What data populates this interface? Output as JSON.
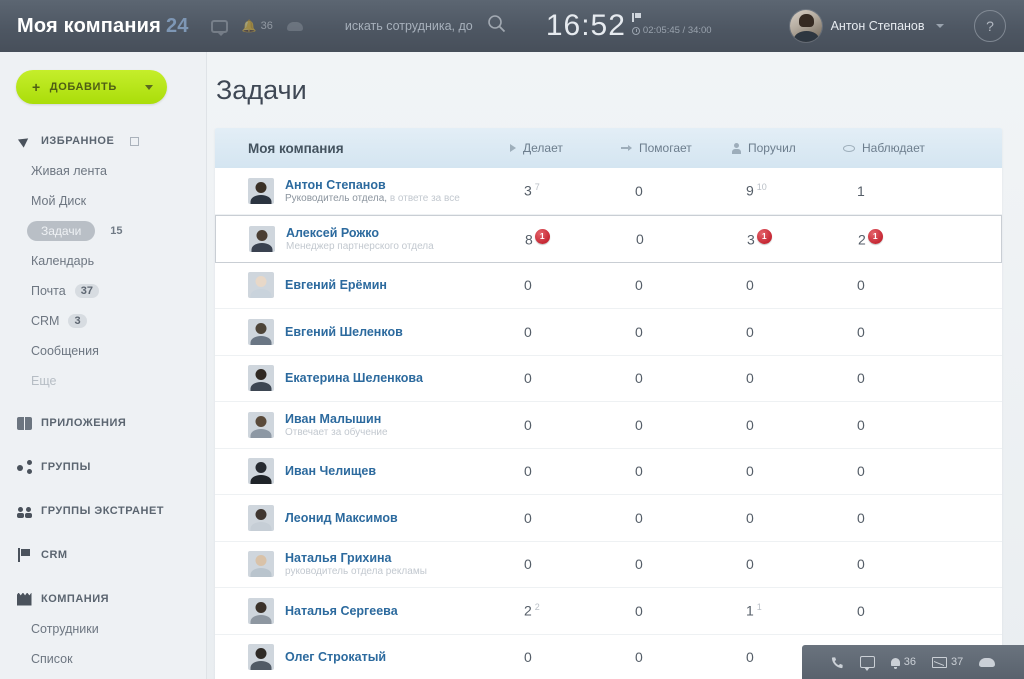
{
  "header": {
    "logo_text": "Моя компания",
    "logo_badge": "24",
    "chat_icon": "chat-icon",
    "notify_icon": "bell-icon",
    "notify_count": "36",
    "cloud_icon": "cloud-icon",
    "search_placeholder": "искать сотрудника, до",
    "search_value": "",
    "search_icon": "search-icon",
    "clock": "16:52",
    "timer": "02:05:45 / 34:00",
    "user_name": "Антон Степанов",
    "help_label": "?"
  },
  "sidebar": {
    "add_button": "ДОБАВИТЬ",
    "groups": [
      {
        "label": "ИЗБРАННОЕ",
        "icon": "pin-icon",
        "has_settings": true,
        "items": [
          {
            "label": "Живая лента",
            "count": "",
            "state": "normal"
          },
          {
            "label": "Мой Диск",
            "count": "",
            "state": "normal"
          },
          {
            "label": "Задачи",
            "count": "15",
            "state": "active"
          },
          {
            "label": "Календарь",
            "count": "",
            "state": "normal"
          },
          {
            "label": "Почта",
            "count": "37",
            "state": "normal"
          },
          {
            "label": "CRM",
            "count": "3",
            "state": "normal"
          },
          {
            "label": "Сообщения",
            "count": "",
            "state": "normal"
          },
          {
            "label": "Еще",
            "count": "",
            "state": "faint"
          }
        ]
      },
      {
        "label": "ПРИЛОЖЕНИЯ",
        "icon": "apps-icon",
        "items": []
      },
      {
        "label": "ГРУППЫ",
        "icon": "share-icon",
        "items": []
      },
      {
        "label": "ГРУППЫ ЭКСТРАНЕТ",
        "icon": "extranet-icon",
        "items": []
      },
      {
        "label": "CRM",
        "icon": "flag-icon",
        "items": []
      },
      {
        "label": "КОМПАНИЯ",
        "icon": "company-icon",
        "items": [
          {
            "label": "Сотрудники",
            "count": "",
            "state": "normal"
          },
          {
            "label": "Список",
            "count": "",
            "state": "normal"
          }
        ]
      }
    ]
  },
  "main": {
    "page_title": "Задачи",
    "grid": {
      "name_header": "Моя компания",
      "columns": [
        {
          "label": "Делает",
          "icon": "play-icon"
        },
        {
          "label": "Помогает",
          "icon": "arrow-right-icon"
        },
        {
          "label": "Поручил",
          "icon": "person-icon"
        },
        {
          "label": "Наблюдает",
          "icon": "eye-icon"
        }
      ],
      "rows": [
        {
          "name": "Антон Степанов",
          "subtitle": "Руководитель отдела,",
          "subtitle_muted": "в ответе за все",
          "selected": false,
          "cells": [
            {
              "value": "3",
              "sup": "7",
              "badge": ""
            },
            {
              "value": "0",
              "sup": "",
              "badge": ""
            },
            {
              "value": "9",
              "sup": "10",
              "badge": ""
            },
            {
              "value": "1",
              "sup": "",
              "badge": ""
            }
          ]
        },
        {
          "name": "Алексей Рожко",
          "subtitle": "",
          "subtitle_muted": "Менеджер партнерского отдела",
          "selected": true,
          "cells": [
            {
              "value": "8",
              "sup": "",
              "badge": "1"
            },
            {
              "value": "0",
              "sup": "",
              "badge": ""
            },
            {
              "value": "3",
              "sup": "",
              "badge": "1"
            },
            {
              "value": "2",
              "sup": "",
              "badge": "1"
            }
          ]
        },
        {
          "name": "Евгений Ерёмин",
          "subtitle": "",
          "subtitle_muted": "",
          "selected": false,
          "cells": [
            {
              "value": "0",
              "sup": "",
              "badge": ""
            },
            {
              "value": "0",
              "sup": "",
              "badge": ""
            },
            {
              "value": "0",
              "sup": "",
              "badge": ""
            },
            {
              "value": "0",
              "sup": "",
              "badge": ""
            }
          ]
        },
        {
          "name": "Евгений Шеленков",
          "subtitle": "",
          "subtitle_muted": "",
          "selected": false,
          "cells": [
            {
              "value": "0",
              "sup": "",
              "badge": ""
            },
            {
              "value": "0",
              "sup": "",
              "badge": ""
            },
            {
              "value": "0",
              "sup": "",
              "badge": ""
            },
            {
              "value": "0",
              "sup": "",
              "badge": ""
            }
          ]
        },
        {
          "name": "Екатерина Шеленкова",
          "subtitle": "",
          "subtitle_muted": "",
          "selected": false,
          "cells": [
            {
              "value": "0",
              "sup": "",
              "badge": ""
            },
            {
              "value": "0",
              "sup": "",
              "badge": ""
            },
            {
              "value": "0",
              "sup": "",
              "badge": ""
            },
            {
              "value": "0",
              "sup": "",
              "badge": ""
            }
          ]
        },
        {
          "name": "Иван Малышин",
          "subtitle": "",
          "subtitle_muted": "Отвечает за обучение",
          "selected": false,
          "cells": [
            {
              "value": "0",
              "sup": "",
              "badge": ""
            },
            {
              "value": "0",
              "sup": "",
              "badge": ""
            },
            {
              "value": "0",
              "sup": "",
              "badge": ""
            },
            {
              "value": "0",
              "sup": "",
              "badge": ""
            }
          ]
        },
        {
          "name": "Иван Челищев",
          "subtitle": "",
          "subtitle_muted": "",
          "selected": false,
          "cells": [
            {
              "value": "0",
              "sup": "",
              "badge": ""
            },
            {
              "value": "0",
              "sup": "",
              "badge": ""
            },
            {
              "value": "0",
              "sup": "",
              "badge": ""
            },
            {
              "value": "0",
              "sup": "",
              "badge": ""
            }
          ]
        },
        {
          "name": "Леонид Максимов",
          "subtitle": "",
          "subtitle_muted": "",
          "selected": false,
          "cells": [
            {
              "value": "0",
              "sup": "",
              "badge": ""
            },
            {
              "value": "0",
              "sup": "",
              "badge": ""
            },
            {
              "value": "0",
              "sup": "",
              "badge": ""
            },
            {
              "value": "0",
              "sup": "",
              "badge": ""
            }
          ]
        },
        {
          "name": "Наталья Грихина",
          "subtitle": "",
          "subtitle_muted": "руководитель отдела рекламы",
          "selected": false,
          "cells": [
            {
              "value": "0",
              "sup": "",
              "badge": ""
            },
            {
              "value": "0",
              "sup": "",
              "badge": ""
            },
            {
              "value": "0",
              "sup": "",
              "badge": ""
            },
            {
              "value": "0",
              "sup": "",
              "badge": ""
            }
          ]
        },
        {
          "name": "Наталья Сергеева",
          "subtitle": "",
          "subtitle_muted": "",
          "selected": false,
          "cells": [
            {
              "value": "2",
              "sup": "2",
              "badge": ""
            },
            {
              "value": "0",
              "sup": "",
              "badge": ""
            },
            {
              "value": "1",
              "sup": "1",
              "badge": ""
            },
            {
              "value": "0",
              "sup": "",
              "badge": ""
            }
          ]
        },
        {
          "name": "Олег Строкатый",
          "subtitle": "",
          "subtitle_muted": "",
          "selected": false,
          "cells": [
            {
              "value": "0",
              "sup": "",
              "badge": ""
            },
            {
              "value": "0",
              "sup": "",
              "badge": ""
            },
            {
              "value": "0",
              "sup": "",
              "badge": ""
            },
            {
              "value": "",
              "sup": "",
              "badge": ""
            }
          ]
        }
      ]
    }
  },
  "bottombar": {
    "phone_icon": "phone-icon",
    "chat_icon": "chat-icon",
    "bell_icon": "bell-icon",
    "bell_count": "36",
    "mail_icon": "mail-icon",
    "mail_count": "37",
    "cloud_icon": "cloud-icon"
  },
  "colors": {
    "accent_green": "#b6e218",
    "header_bg": "#4e5763",
    "link_blue": "#2c6a9e",
    "badge_red": "#c42430"
  }
}
